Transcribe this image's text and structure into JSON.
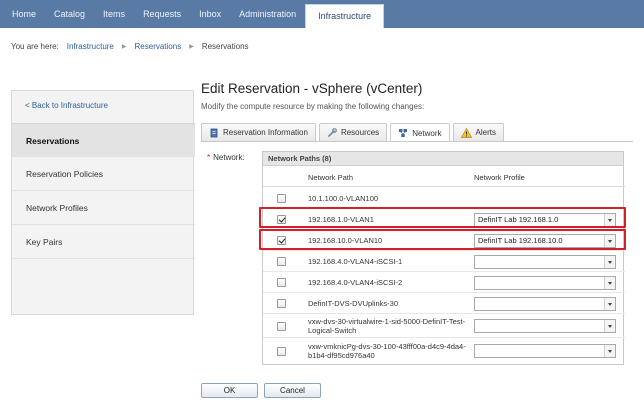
{
  "topnav": {
    "tabs": [
      {
        "label": "Home"
      },
      {
        "label": "Catalog"
      },
      {
        "label": "Items"
      },
      {
        "label": "Requests"
      },
      {
        "label": "Inbox"
      },
      {
        "label": "Administration"
      },
      {
        "label": "Infrastructure",
        "active": true
      }
    ]
  },
  "breadcrumb": {
    "prefix": "You are here:",
    "items": [
      "Infrastructure",
      "Reservations",
      "Reservations"
    ]
  },
  "sidebar": {
    "back": "< Back to Infrastructure",
    "items": [
      {
        "label": "Reservations",
        "active": true
      },
      {
        "label": "Reservation Policies"
      },
      {
        "label": "Network Profiles"
      },
      {
        "label": "Key Pairs"
      }
    ]
  },
  "main": {
    "title": "Edit Reservation - vSphere (vCenter)",
    "subtitle": "Modify the compute resource by making the following changes:",
    "tabs": [
      {
        "label": "Reservation Information",
        "icon": "document-icon"
      },
      {
        "label": "Resources",
        "icon": "wrench-icon"
      },
      {
        "label": "Network",
        "icon": "network-icon",
        "active": true
      },
      {
        "label": "Alerts",
        "icon": "warning-icon"
      }
    ],
    "network_label": "Network:",
    "required_mark": "*",
    "grid": {
      "header": "Network Paths (8)",
      "columns": [
        "Network Path",
        "Network Profile"
      ],
      "rows": [
        {
          "path": "10.1.100.0-VLAN100",
          "checked": false,
          "profile": ""
        },
        {
          "path": "192.168.1.0-VLAN1",
          "checked": true,
          "profile": "DefinIT Lab 192.168.1.0"
        },
        {
          "path": "192.168.10.0-VLAN10",
          "checked": true,
          "profile": "DefinIT Lab 192.168.10.0"
        },
        {
          "path": "192.168.4.0-VLAN4-iSCSI-1",
          "checked": false,
          "profile": ""
        },
        {
          "path": "192.168.4.0-VLAN4-iSCSI-2",
          "checked": false,
          "profile": ""
        },
        {
          "path": "DefinIT-DVS-DVUplinks-30",
          "checked": false,
          "profile": ""
        },
        {
          "path": "vxw-dvs-30-virtualwire-1-sid-5000-DefinIT-Test-Logical-Switch",
          "checked": false,
          "profile": ""
        },
        {
          "path": "vxw-vmknicPg-dvs-30-100-43fff00a-d4c9-4da4-b1b4-df95cd976a40",
          "checked": false,
          "profile": ""
        }
      ]
    },
    "buttons": {
      "ok": "OK",
      "cancel": "Cancel"
    },
    "highlight_color": "#d0202a"
  }
}
